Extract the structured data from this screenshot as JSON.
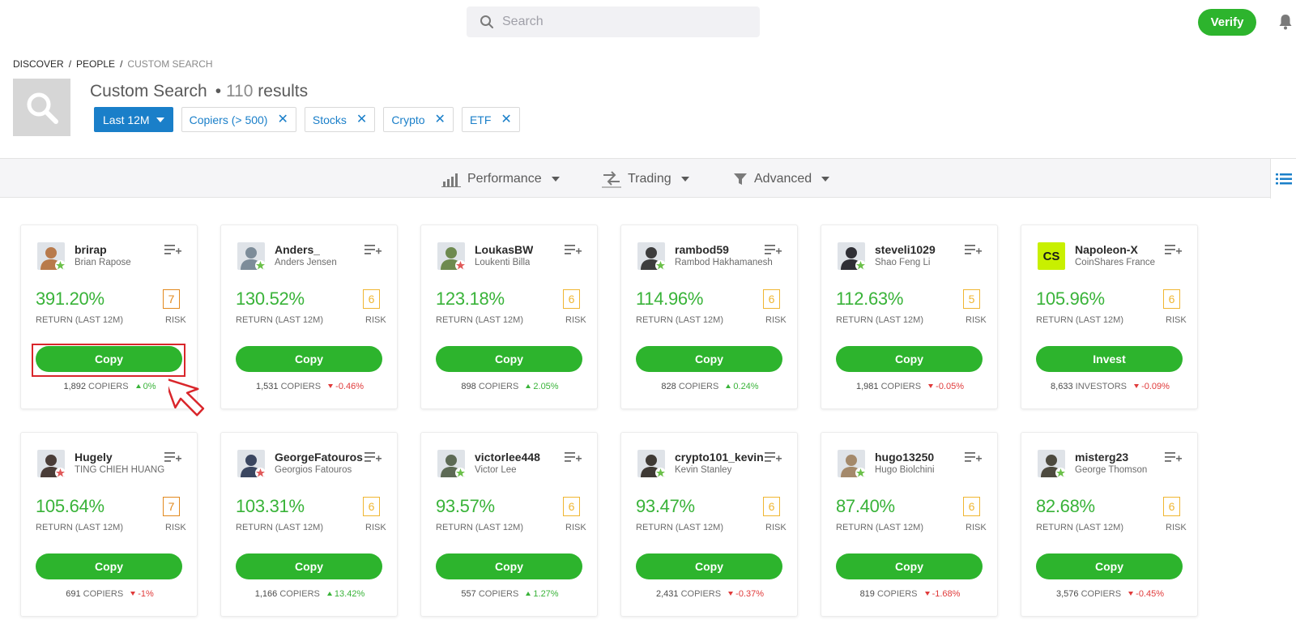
{
  "topbar": {
    "search_placeholder": "Search",
    "verify_label": "Verify"
  },
  "breadcrumb": {
    "items": [
      "DISCOVER",
      "PEOPLE"
    ],
    "current": "CUSTOM SEARCH"
  },
  "header": {
    "title": "Custom Search",
    "results_prefix": "•",
    "results_count": "110",
    "results_label": "results"
  },
  "filters": {
    "period": "Last 12M",
    "chips": [
      "Copiers (> 500)",
      "Stocks",
      "Crypto",
      "ETF"
    ]
  },
  "sortbar": {
    "performance": "Performance",
    "trading": "Trading",
    "advanced": "Advanced"
  },
  "labels": {
    "return": "RETURN (LAST 12M)",
    "risk": "RISK"
  },
  "colors": {
    "green": "#2db42d",
    "blue": "#1a7fc9",
    "risk_amber": "#f0b632",
    "risk_orange": "#e2891e",
    "negative": "#e03a3a"
  },
  "cards": [
    {
      "username": "brirap",
      "fullname": "Brian Rapose",
      "return": "391.20%",
      "risk": "7",
      "button": "Copy",
      "count": "1,892",
      "count_label": "COPIERS",
      "change": "0%",
      "dir": "up",
      "star": "green",
      "avatar_bg": "#b87a4b"
    },
    {
      "username": "Anders_",
      "fullname": "Anders Jensen",
      "return": "130.52%",
      "risk": "6",
      "button": "Copy",
      "count": "1,531",
      "count_label": "COPIERS",
      "change": "-0.46%",
      "dir": "down",
      "star": "green",
      "avatar_bg": "#7d8c99"
    },
    {
      "username": "LoukasBW",
      "fullname": "Loukenti Billa",
      "return": "123.18%",
      "risk": "6",
      "button": "Copy",
      "count": "898",
      "count_label": "COPIERS",
      "change": "2.05%",
      "dir": "up",
      "star": "red",
      "avatar_bg": "#6e8a4f"
    },
    {
      "username": "rambod59",
      "fullname": "Rambod Hakhamanesh",
      "return": "114.96%",
      "risk": "6",
      "button": "Copy",
      "count": "828",
      "count_label": "COPIERS",
      "change": "0.24%",
      "dir": "up",
      "star": "green",
      "avatar_bg": "#3d3d3d"
    },
    {
      "username": "steveli1029",
      "fullname": "Shao Feng Li",
      "return": "112.63%",
      "risk": "5",
      "button": "Copy",
      "count": "1,981",
      "count_label": "COPIERS",
      "change": "-0.05%",
      "dir": "down",
      "star": "green",
      "avatar_bg": "#2f2f35"
    },
    {
      "username": "Napoleon-X",
      "fullname": "CoinShares France",
      "return": "105.96%",
      "risk": "6",
      "button": "Invest",
      "count": "8,633",
      "count_label": "INVESTORS",
      "change": "-0.09%",
      "dir": "down",
      "star": "none",
      "avatar_bg": "#c8f000",
      "avatar_text": "CS"
    },
    {
      "username": "Hugely",
      "fullname": "TING CHIEH HUANG",
      "return": "105.64%",
      "risk": "7",
      "button": "Copy",
      "count": "691",
      "count_label": "COPIERS",
      "change": "-1%",
      "dir": "down",
      "star": "red",
      "avatar_bg": "#4a3d38"
    },
    {
      "username": "GeorgeFatouros",
      "fullname": "Georgios Fatouros",
      "return": "103.31%",
      "risk": "6",
      "button": "Copy",
      "count": "1,166",
      "count_label": "COPIERS",
      "change": "13.42%",
      "dir": "up",
      "star": "red",
      "avatar_bg": "#3a4660"
    },
    {
      "username": "victorlee448",
      "fullname": "Victor Lee",
      "return": "93.57%",
      "risk": "6",
      "button": "Copy",
      "count": "557",
      "count_label": "COPIERS",
      "change": "1.27%",
      "dir": "up",
      "star": "green",
      "avatar_bg": "#5d6a55"
    },
    {
      "username": "crypto101_kevin",
      "fullname": "Kevin Stanley",
      "return": "93.47%",
      "risk": "6",
      "button": "Copy",
      "count": "2,431",
      "count_label": "COPIERS",
      "change": "-0.37%",
      "dir": "down",
      "star": "green",
      "avatar_bg": "#3f3a35"
    },
    {
      "username": "hugo13250",
      "fullname": "Hugo Biolchini",
      "return": "87.40%",
      "risk": "6",
      "button": "Copy",
      "count": "819",
      "count_label": "COPIERS",
      "change": "-1.68%",
      "dir": "down",
      "star": "green",
      "avatar_bg": "#a4896b"
    },
    {
      "username": "misterg23",
      "fullname": "George Thomson",
      "return": "82.68%",
      "risk": "6",
      "button": "Copy",
      "count": "3,576",
      "count_label": "COPIERS",
      "change": "-0.45%",
      "dir": "down",
      "star": "green",
      "avatar_bg": "#4d4a3f"
    }
  ]
}
